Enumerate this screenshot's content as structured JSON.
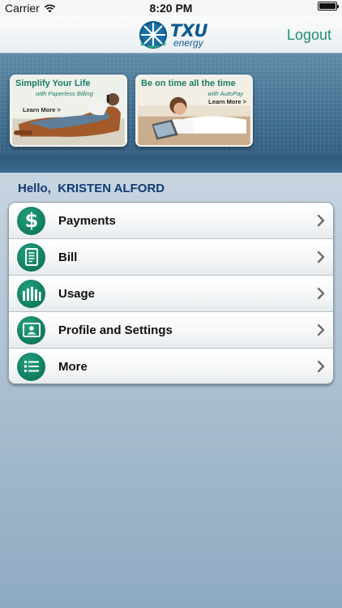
{
  "status_bar": {
    "carrier": "Carrier",
    "time": "8:20 PM",
    "battery_level": 1.0
  },
  "nav": {
    "logo_main": "TXU",
    "logo_sub": "energy",
    "logout_label": "Logout"
  },
  "banner": {
    "promos": [
      {
        "title": "Simplify Your Life",
        "subtitle": "with Paperless Billing",
        "link": "Learn More >"
      },
      {
        "title": "Be on time all the time",
        "subtitle": "with AutoPay",
        "link": "Learn More >"
      }
    ]
  },
  "greeting": {
    "prefix": "Hello,",
    "name": "KRISTEN ALFORD"
  },
  "menu": {
    "items": [
      {
        "label": "Payments",
        "icon": "dollar-icon"
      },
      {
        "label": "Bill",
        "icon": "document-icon"
      },
      {
        "label": "Usage",
        "icon": "bar-chart-icon"
      },
      {
        "label": "Profile and Settings",
        "icon": "id-card-icon"
      },
      {
        "label": "More",
        "icon": "list-icon"
      }
    ]
  },
  "colors": {
    "accent_green": "#1f8f73",
    "icon_green": "#0f7a5f",
    "greeting_blue": "#123a73",
    "logo_blue": "#0d5b8e"
  }
}
